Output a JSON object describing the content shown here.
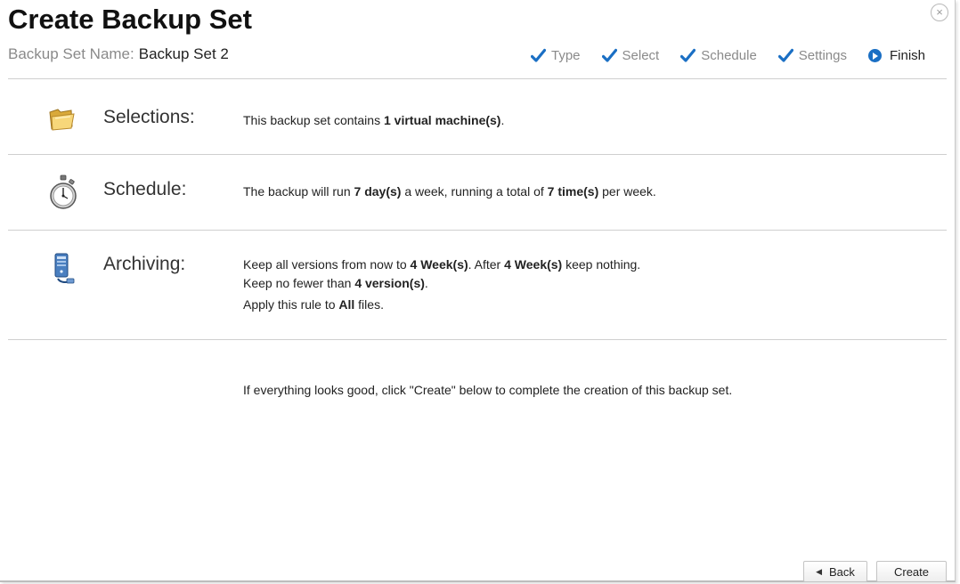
{
  "dialog": {
    "title": "Create Backup Set",
    "close_glyph": "×",
    "set_name_label": "Backup Set Name:",
    "set_name_value": "Backup Set 2"
  },
  "steps": [
    {
      "label": "Type",
      "state": "done",
      "icon": "check-icon"
    },
    {
      "label": "Select",
      "state": "done",
      "icon": "check-icon"
    },
    {
      "label": "Schedule",
      "state": "done",
      "icon": "check-icon"
    },
    {
      "label": "Settings",
      "state": "done",
      "icon": "check-icon"
    },
    {
      "label": "Finish",
      "state": "current",
      "icon": "arrow-circle-icon"
    }
  ],
  "sections": {
    "selections": {
      "label": "Selections:",
      "icon": "folder-icon",
      "line1": {
        "t1": "This backup set contains ",
        "b1": "1 virtual machine(s)",
        "t2": "."
      }
    },
    "schedule": {
      "label": "Schedule:",
      "icon": "stopwatch-icon",
      "line1": {
        "t1": "The backup will run ",
        "b1": "7 day(s)",
        "t2": " a week, running a total of ",
        "b2": "7 time(s)",
        "t3": " per week."
      }
    },
    "archiving": {
      "label": "Archiving:",
      "icon": "server-icon",
      "line1": {
        "t1": "Keep all versions from now to ",
        "b1": "4 Week(s)",
        "t2": ". After ",
        "b2": "4 Week(s)",
        "t3": " keep nothing."
      },
      "line2": {
        "t1": "Keep no fewer than ",
        "b1": "4 version(s)",
        "t2": "."
      },
      "line3": {
        "t1": "Apply this rule to ",
        "b1": "All",
        "t2": " files."
      }
    }
  },
  "footer": {
    "message": "If everything looks good, click \"Create\" below to complete the creation of this backup set."
  },
  "buttons": {
    "back_label": "Back",
    "create_label": "Create"
  },
  "colors": {
    "accent": "#1a6fc4",
    "muted_text": "#8a8a8a",
    "divider": "#cfcfcf"
  }
}
